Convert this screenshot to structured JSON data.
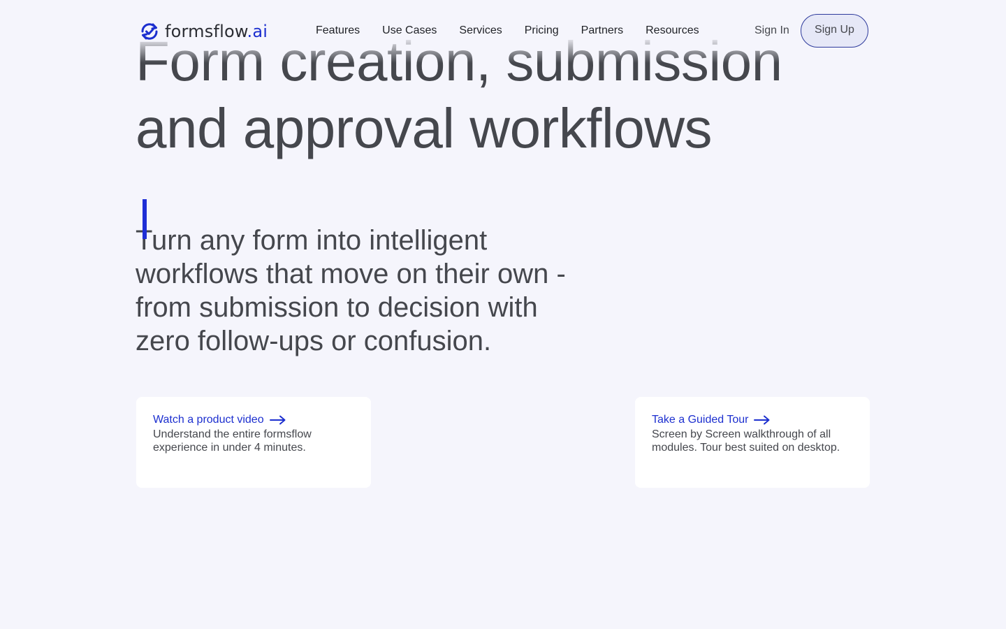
{
  "header": {
    "logo_text": "formsflow",
    "logo_suffix": ".ai",
    "nav": [
      "Features",
      "Use Cases",
      "Services",
      "Pricing",
      "Partners",
      "Resources"
    ],
    "sign_in": "Sign In",
    "sign_up": "Sign Up"
  },
  "hero": {
    "title_line1": "Form creation, submission",
    "title_line2": "and approval workflows",
    "subtitle": "Turn any form into intelligent workflows that move on their own - from submission to decision with zero follow-ups or confusion."
  },
  "cards": [
    {
      "link": "Watch a product video",
      "description": "Understand the entire formsflow experience in under 4 minutes."
    },
    {
      "link": "Take a Guided Tour",
      "description": "Screen by Screen walkthrough of all modules. Tour best suited on desktop."
    }
  ],
  "colors": {
    "background": "#f5f5fc",
    "accent": "#1c2fcf",
    "text": "#45474d",
    "cursor": "#1f2fd6"
  },
  "icons": {
    "logo": "refresh-check-icon",
    "card_arrow": "arrow-right-icon"
  }
}
